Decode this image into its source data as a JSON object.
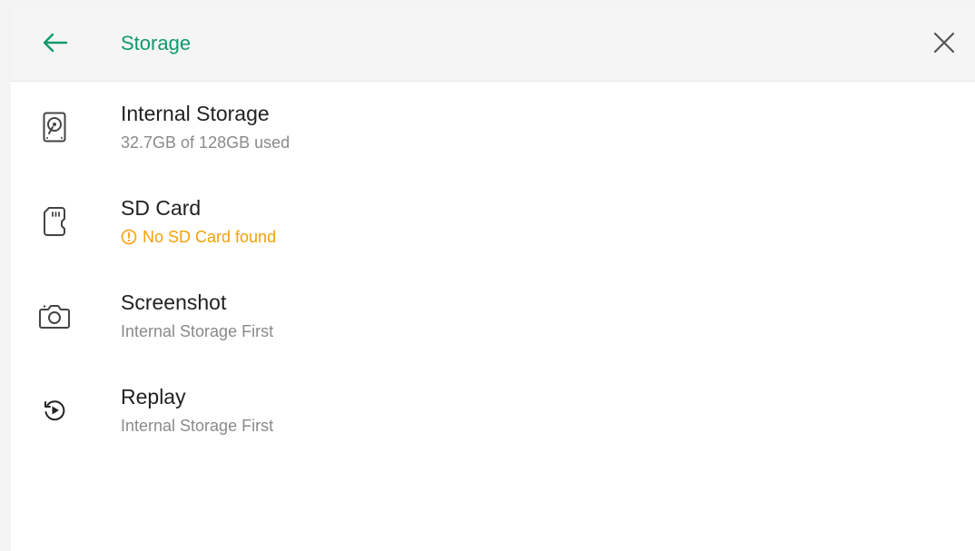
{
  "header": {
    "title": "Storage"
  },
  "items": [
    {
      "label": "Internal Storage",
      "sub": "32.7GB of 128GB used",
      "icon": "hard-drive-icon"
    },
    {
      "label": "SD Card",
      "sub": "No SD Card found",
      "icon": "sd-card-icon",
      "status": "warning"
    },
    {
      "label": "Screenshot",
      "sub": "Internal Storage First",
      "icon": "camera-icon"
    },
    {
      "label": "Replay",
      "sub": "Internal Storage First",
      "icon": "replay-icon"
    }
  ],
  "colors": {
    "accent": "#0f9a6e",
    "warning": "#f5a00a",
    "text": "#222222",
    "subtext": "#8a8a8a"
  }
}
